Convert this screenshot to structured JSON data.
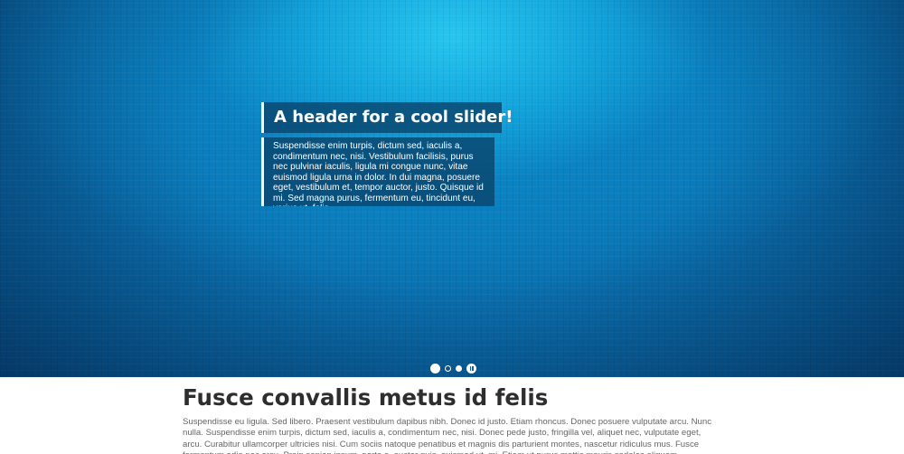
{
  "slider": {
    "title": "A header for a cool slider!",
    "body": "Suspendisse enim turpis, dictum sed, iaculis a, condimentum nec, nisi. Vestibulum facilisis, purus nec pulvinar iaculis, ligula mi congue nunc, vitae euismod ligula urna in dolor. In dui magna, posuere eget, vestibulum et, tempor auctor, justo. Quisque id mi. Sed magna purus, fermentum eu, tincidunt eu, varius ut, felis.",
    "controls": {
      "dots": [
        "active",
        "inactive",
        "filled"
      ],
      "pause_icon": "pause-icon"
    },
    "colors": {
      "highlight": "#27c6f0",
      "base": "#0a6aa8",
      "edge": "#063d68",
      "caption_bg": "#0a466e"
    }
  },
  "content": {
    "heading": "Fusce convallis metus id felis",
    "paragraph": "Suspendisse eu ligula. Sed libero. Praesent vestibulum dapibus nibh. Donec id justo. Etiam rhoncus. Donec posuere vulputate arcu. Nunc nulla. Suspendisse enim turpis, dictum sed, iaculis a, condimentum nec, nisi. Donec pede justo, fringilla vel, aliquet nec, vulputate eget, arcu. Curabitur ullamcorper ultricies nisi. Cum sociis natoque penatibus et magnis dis parturient montes, nascetur ridiculus mus. Fusce fermentum odio nec arcu. Proin sapien ipsum, porta a, auctor quis, euismod ut, mi. Etiam ut purus mattis mauris sodales aliquam. Curabitur nisi. Nulla consequat massa quis enim. Maecenas malesuada. Etiam sollicitudin, ipsum eu pulvinar rutrum."
  }
}
